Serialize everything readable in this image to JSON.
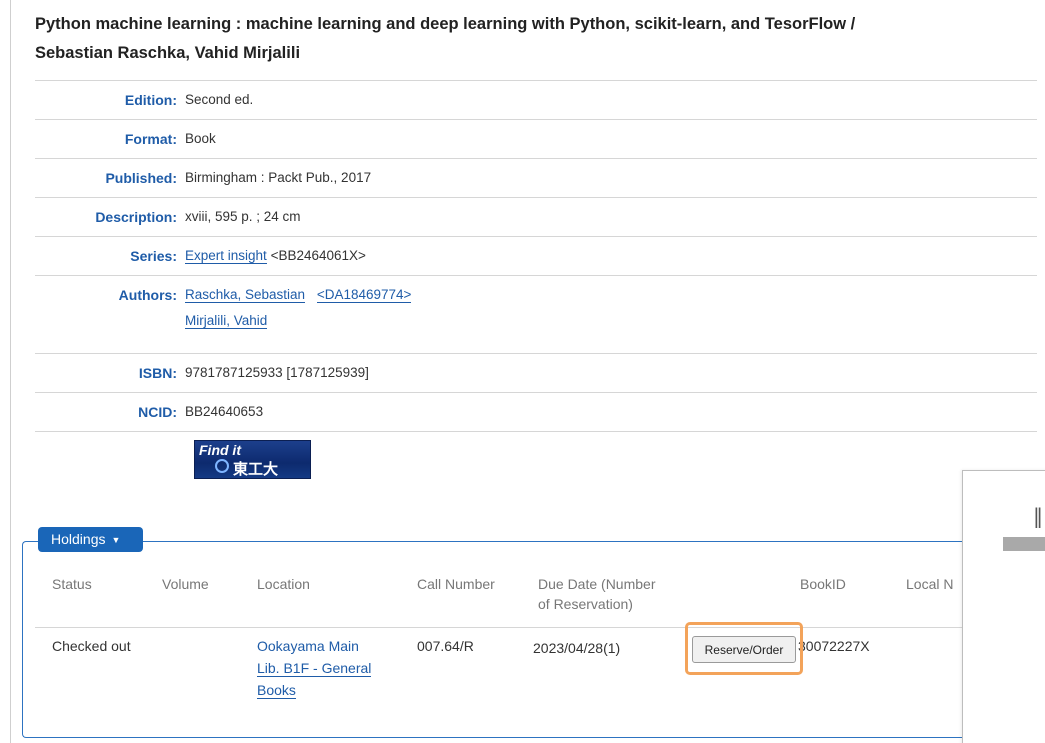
{
  "record": {
    "title_line1": "Python machine learning : machine learning and deep learning with Python, scikit-learn, and TesorFlow /",
    "title_line2": "Sebastian Raschka, Vahid Mirjalili"
  },
  "fields": {
    "edition": {
      "label": "Edition:",
      "value": "Second ed."
    },
    "format": {
      "label": "Format:",
      "value": "Book"
    },
    "published": {
      "label": "Published:",
      "value": "Birmingham : Packt Pub., 2017"
    },
    "description": {
      "label": "Description:",
      "value": "xviii, 595 p. ; 24 cm"
    },
    "series": {
      "label": "Series:",
      "link": "Expert insight",
      "id": "<BB2464061X>"
    },
    "authors": {
      "label": "Authors:",
      "author1": "Raschka, Sebastian",
      "author1_id": "<DA18469774>",
      "author2": "Mirjalili, Vahid"
    },
    "isbn": {
      "label": "ISBN:",
      "value": "9781787125933 [1787125939]"
    },
    "ncid": {
      "label": "NCID:",
      "value": "BB24640653"
    }
  },
  "findit": {
    "text": "Find it",
    "jp": "東工大"
  },
  "holdings": {
    "tab_label": "Holdings",
    "columns": {
      "status": "Status",
      "volume": "Volume",
      "location": "Location",
      "call_number": "Call Number",
      "due_date_1": "Due Date (Number",
      "due_date_2": "of Reservation)",
      "bookid": "BookID",
      "local": "Local N"
    },
    "row": {
      "status": "Checked out",
      "volume": "",
      "location_1": "Ookayama Main",
      "location_2": "Lib. B1F - General",
      "location_3": "Books",
      "call_number": "007.64/R",
      "due_date": "2023/04/28(1)",
      "reserve_label": "Reserve/Order",
      "bookid": "30072227X"
    }
  },
  "overlay": {
    "icon": "pause-icon"
  },
  "colors": {
    "link": "#1f5ca8",
    "tab": "#1a66b8",
    "highlight": "#f3a35a"
  }
}
